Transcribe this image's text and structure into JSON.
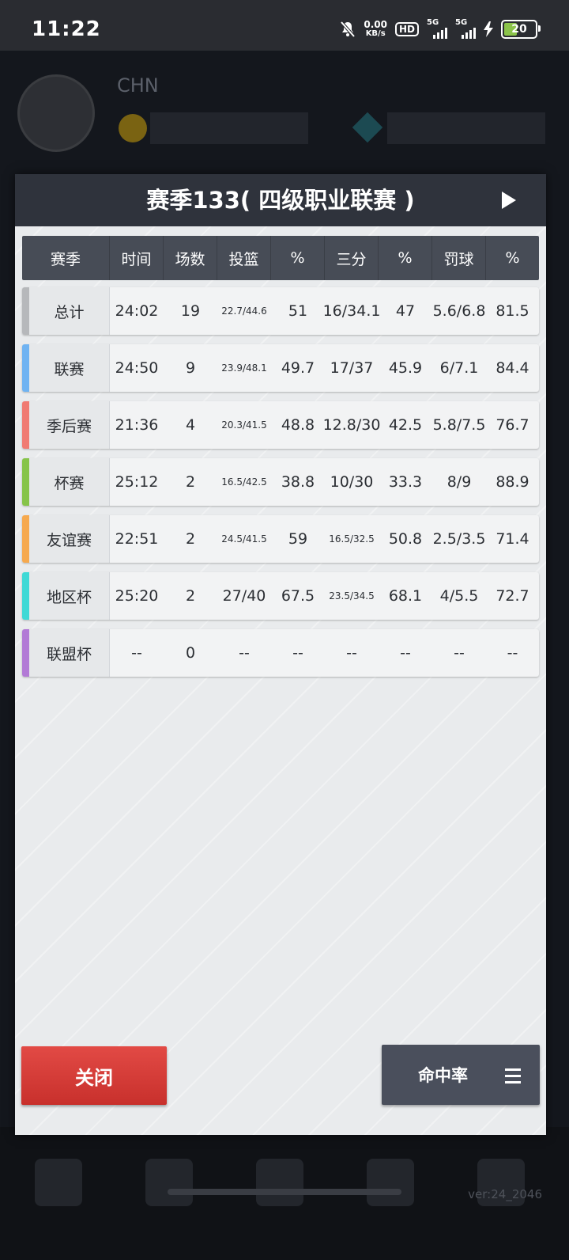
{
  "status_bar": {
    "time": "11:22",
    "net_speed": "0.00",
    "net_unit": "KB/s",
    "hd": "HD",
    "sim1": "5G",
    "sim2": "5G",
    "battery": "20",
    "battery_color": "#8bc34a"
  },
  "background": {
    "player_name": "CHN",
    "player_tag": "",
    "coins": "",
    "gems": "",
    "tabs": [
      "",
      "",
      "",
      "",
      ""
    ],
    "version": "ver:24_2046"
  },
  "dialog": {
    "title": "赛季133( 四级职业联赛 )",
    "headers": [
      "赛季",
      "时间",
      "场数",
      "投篮",
      "%",
      "三分",
      "%",
      "罚球",
      "%"
    ],
    "rows": [
      {
        "name": "总计",
        "color": "#b6b8bb",
        "cells": [
          "24:02",
          "19",
          "22.7/44.6",
          "51",
          "16/34.1",
          "47",
          "5.6/6.8",
          "81.5"
        ]
      },
      {
        "name": "联赛",
        "color": "#6fb3f2",
        "cells": [
          "24:50",
          "9",
          "23.9/48.1",
          "49.7",
          "17/37",
          "45.9",
          "6/7.1",
          "84.4"
        ]
      },
      {
        "name": "季后赛",
        "color": "#f07a72",
        "cells": [
          "21:36",
          "4",
          "20.3/41.5",
          "48.8",
          "12.8/30",
          "42.5",
          "5.8/7.5",
          "76.7"
        ]
      },
      {
        "name": "杯赛",
        "color": "#86c449",
        "cells": [
          "25:12",
          "2",
          "16.5/42.5",
          "38.8",
          "10/30",
          "33.3",
          "8/9",
          "88.9"
        ]
      },
      {
        "name": "友谊赛",
        "color": "#f6a94e",
        "cells": [
          "22:51",
          "2",
          "24.5/41.5",
          "59",
          "16.5/32.5",
          "50.8",
          "2.5/3.5",
          "71.4"
        ]
      },
      {
        "name": "地区杯",
        "color": "#3fd9d6",
        "cells": [
          "25:20",
          "2",
          "27/40",
          "67.5",
          "23.5/34.5",
          "68.1",
          "4/5.5",
          "72.7"
        ]
      },
      {
        "name": "联盟杯",
        "color": "#b27ad6",
        "cells": [
          "--",
          "0",
          "--",
          "--",
          "--",
          "--",
          "--",
          "--"
        ]
      }
    ],
    "close_label": "关闭",
    "rate_label": "命中率"
  }
}
